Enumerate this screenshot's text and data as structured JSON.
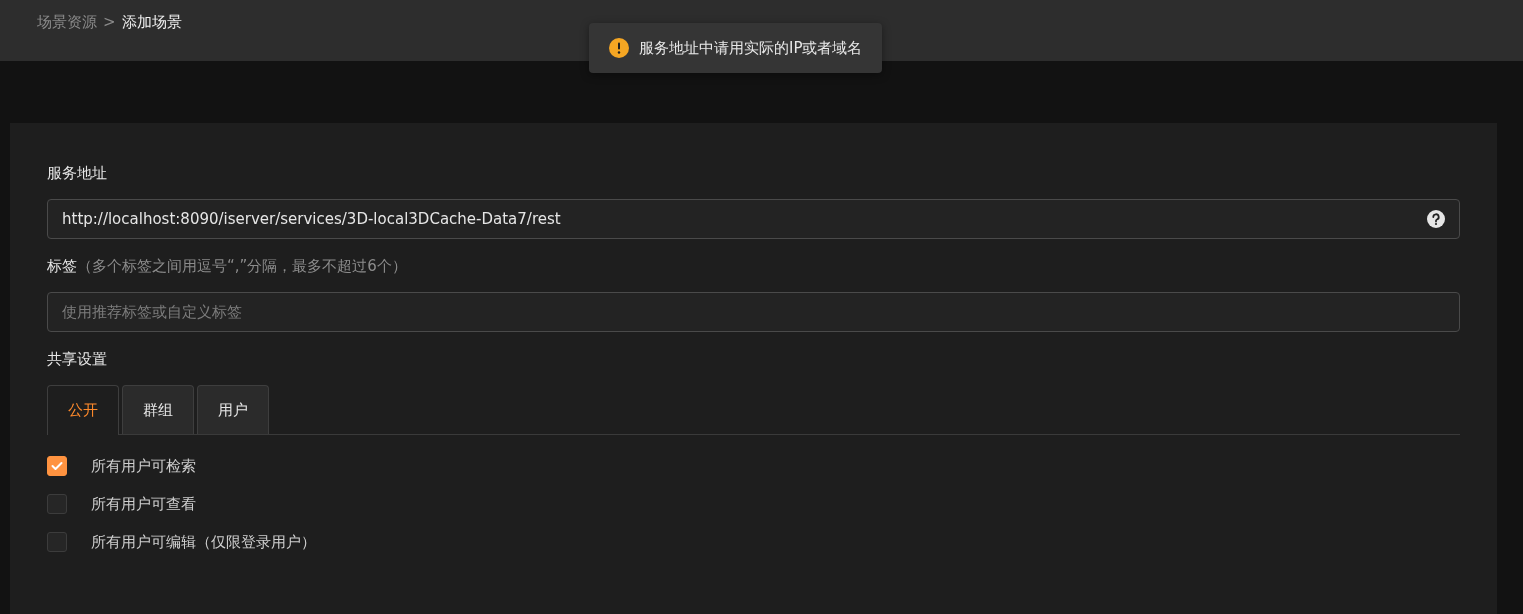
{
  "breadcrumb": [
    {
      "label": "场景资源",
      "current": false
    },
    {
      "label": "添加场景",
      "current": true
    }
  ],
  "breadcrumb_separator": ">",
  "toast": {
    "message": "服务地址中请用实际的IP或者域名"
  },
  "service_address": {
    "label": "服务地址",
    "value": "http://localhost:8090/iserver/services/3D-local3DCache-Data7/rest"
  },
  "tags": {
    "label": "标签",
    "hint": "（多个标签之间用逗号“,”分隔，最多不超过6个）",
    "placeholder": "使用推荐标签或自定义标签"
  },
  "sharing": {
    "label": "共享设置",
    "tabs": [
      {
        "label": "公开",
        "selected": true
      },
      {
        "label": "群组",
        "selected": false
      },
      {
        "label": "用户",
        "selected": false
      }
    ],
    "options": [
      {
        "label": "所有用户可检索",
        "checked": true
      },
      {
        "label": "所有用户可查看",
        "checked": false
      },
      {
        "label": "所有用户可编辑（仅限登录用户）",
        "checked": false
      }
    ]
  }
}
